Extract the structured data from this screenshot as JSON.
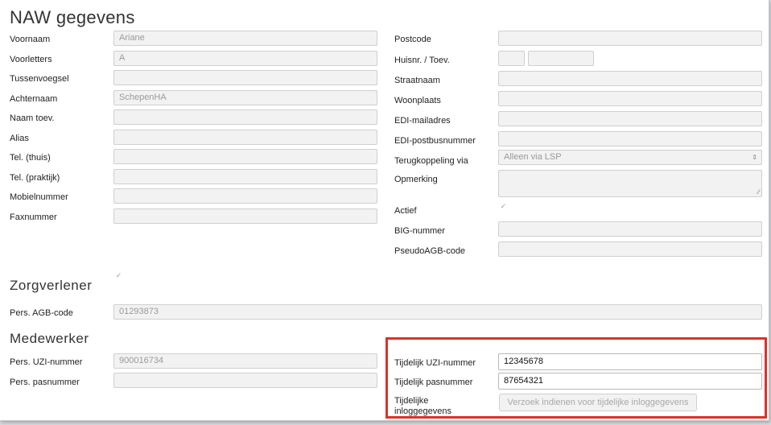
{
  "header": {
    "title": "NAW gegevens"
  },
  "naw_left": [
    {
      "label": "Voornaam",
      "value": "Ariane"
    },
    {
      "label": "Voorletters",
      "value": "A"
    },
    {
      "label": "Tussenvoegsel",
      "value": ""
    },
    {
      "label": "Achternaam",
      "value": "SchepenHA"
    },
    {
      "label": "Naam toev.",
      "value": ""
    },
    {
      "label": "Alias",
      "value": ""
    },
    {
      "label": "Tel. (thuis)",
      "value": ""
    },
    {
      "label": "Tel. (praktijk)",
      "value": ""
    },
    {
      "label": "Mobielnummer",
      "value": ""
    },
    {
      "label": "Faxnummer",
      "value": ""
    }
  ],
  "naw_right": {
    "postcode": {
      "label": "Postcode",
      "value": ""
    },
    "huisnr": {
      "label": "Huisnr. / Toev.",
      "number": "",
      "addition": ""
    },
    "straatnaam": {
      "label": "Straatnaam",
      "value": ""
    },
    "woonplaats": {
      "label": "Woonplaats",
      "value": ""
    },
    "edi_mail": {
      "label": "EDI-mailadres",
      "value": ""
    },
    "edi_postbus": {
      "label": "EDI-postbusnummer",
      "value": ""
    },
    "terugkoppeling": {
      "label": "Terugkoppeling via",
      "value": "Alleen via LSP"
    },
    "opmerking": {
      "label": "Opmerking",
      "value": ""
    },
    "actief": {
      "label": "Actief",
      "checked": true
    },
    "big": {
      "label": "BIG-nummer",
      "value": ""
    },
    "pseudo_agb": {
      "label": "PseudoAGB-code",
      "value": ""
    }
  },
  "zorgverlener": {
    "title": "Zorgverlener",
    "checked": true,
    "agb_label": "Pers. AGB-code",
    "agb_value": "01293873"
  },
  "medewerker": {
    "title": "Medewerker",
    "uzi_label": "Pers. UZI-nummer",
    "uzi_value": "900016734",
    "pas_label": "Pers. pasnummer",
    "pas_value": "",
    "temp_uzi_label": "Tijdelijk UZI-nummer",
    "temp_uzi_value": "12345678",
    "temp_pas_label": "Tijdelijk pasnummer",
    "temp_pas_value": "87654321",
    "temp_login_label_line1": "Tijdelijke",
    "temp_login_label_line2": "inloggegevens",
    "request_button": "Verzoek indienen voor tijdelijke inloggegevens"
  },
  "colors": {
    "highlight": "#d9322b",
    "field_disabled": "#f2f2f2"
  },
  "icons": {
    "check": "check-icon",
    "select_arrows": "select-arrows-icon",
    "resize": "resize-grip-icon"
  }
}
